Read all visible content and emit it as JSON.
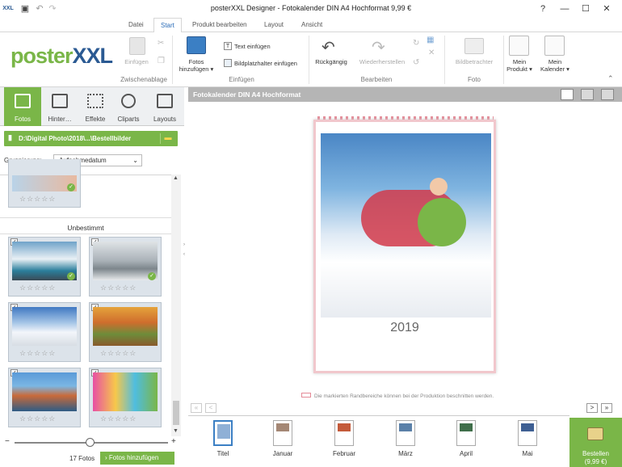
{
  "app": {
    "window_title": "posterXXL Designer - Fotokalender DIN A4 Hochformat 9,99 €",
    "logo_a": "poster",
    "logo_b": "XXL",
    "quick_logo": "XXL"
  },
  "window_controls": {
    "help": "?",
    "minimize": "—",
    "maximize": "☐",
    "close": "✕"
  },
  "tabs": [
    {
      "label": "Datei"
    },
    {
      "label": "Start"
    },
    {
      "label": "Produkt bearbeiten"
    },
    {
      "label": "Layout"
    },
    {
      "label": "Ansicht"
    }
  ],
  "ribbon": {
    "einfuegen": "Einfügen",
    "zwischenablage": "Zwischenablage",
    "fotos_hinzufuegen_1": "Fotos",
    "fotos_hinzufuegen_2": "hinzufügen",
    "text_einfuegen": "Text einfügen",
    "bildplatzhalter": "Bildplatzhalter einfügen",
    "einfuegen_group": "Einfügen",
    "rueckgaengig": "Rückgängig",
    "wiederherstellen": "Wiederherstellen",
    "bearbeiten": "Bearbeiten",
    "bildbetrachter": "Bildbetrachter",
    "foto": "Foto",
    "mein_produkt_1": "Mein",
    "mein_produkt_2": "Produkt",
    "mein_kalender_1": "Mein",
    "mein_kalender_2": "Kalender"
  },
  "sidebar": {
    "tabs": [
      {
        "label": "Fotos"
      },
      {
        "label": "Hinter…"
      },
      {
        "label": "Effekte"
      },
      {
        "label": "Cliparts"
      },
      {
        "label": "Layouts"
      }
    ],
    "path": "D:\\Digital Photo\\2018\\...\\Bestellbilder",
    "gruppierung_label": "Gruppierung:",
    "gruppierung_value": "Aufnahmedatum",
    "section_label": "Unbestimmt",
    "stars": "☆☆☆☆☆",
    "check": "✓",
    "count": "17 Fotos",
    "add_button": "Fotos hinzufügen",
    "slider_minus": "−",
    "slider_plus": "+"
  },
  "main": {
    "title": "Fotokalender DIN A4 Hochformat",
    "year": "2019",
    "note": "Die markierten Randbereiche können bei der Produktion beschnitten werden."
  },
  "filmstrip": {
    "pages": [
      {
        "label": "Titel"
      },
      {
        "label": "Januar"
      },
      {
        "label": "Februar"
      },
      {
        "label": "März"
      },
      {
        "label": "April"
      },
      {
        "label": "Mai"
      }
    ]
  },
  "order": {
    "label": "Bestellen",
    "price": "(9,99 €)"
  },
  "nav": {
    "first": "«",
    "prev": "<",
    "next": ">",
    "last": "»"
  }
}
